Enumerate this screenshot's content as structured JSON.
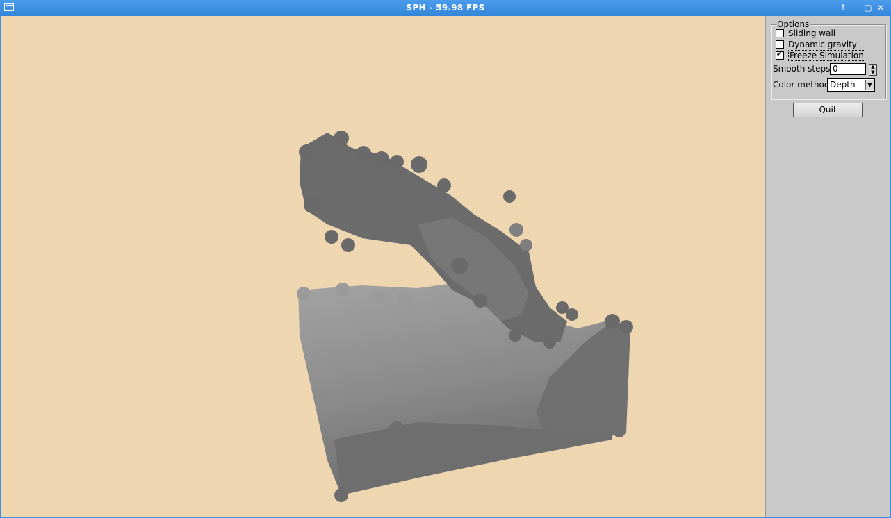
{
  "window": {
    "title": "SPH - 59.98 FPS",
    "controls": [
      "raise-icon",
      "minimize-icon",
      "maximize-icon",
      "close-icon"
    ]
  },
  "viewport": {
    "background": "#eed6b1",
    "particle_color_dark": "#6b6b6b",
    "particle_color_light": "#9a9a9a"
  },
  "options": {
    "title": "Options",
    "sliding_wall": {
      "label": "Sliding wall",
      "checked": false
    },
    "dynamic_gravity": {
      "label": "Dynamic gravity",
      "checked": false
    },
    "freeze_simulation": {
      "label": "Freeze Simulation",
      "checked": true
    },
    "smooth_steps": {
      "label": "Smooth steps",
      "value": "0"
    },
    "color_method": {
      "label": "Color method",
      "value": "Depth"
    }
  },
  "quit_label": "Quit"
}
